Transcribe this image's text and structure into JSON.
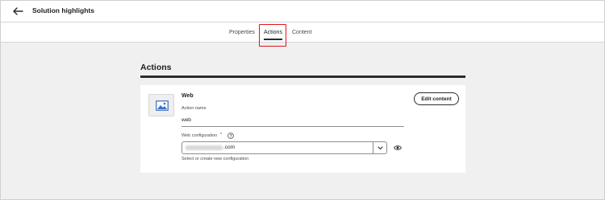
{
  "header": {
    "title": "Solution highlights",
    "back_icon": "arrow-left-icon"
  },
  "tabs": [
    {
      "label": "Properties",
      "active": false
    },
    {
      "label": "Actions",
      "active": true
    },
    {
      "label": "Content",
      "active": false
    }
  ],
  "colors": {
    "highlight": "#e0141e",
    "text": "#1e1e1e",
    "background": "#f0f0f0",
    "card": "#ffffff"
  },
  "section": {
    "title": "Actions"
  },
  "action": {
    "channel_icon": "image-icon",
    "title": "Web",
    "name_label": "Action name",
    "name_value": "web",
    "config_label": "Web configuration",
    "required_mark": "*",
    "help_icon": "help-circle-icon",
    "config_value_suffix": ".com",
    "dropdown_icon": "chevron-down-icon",
    "preview_icon": "eye-icon",
    "helper_text": "Select or create new configuration",
    "edit_label": "Edit content"
  }
}
